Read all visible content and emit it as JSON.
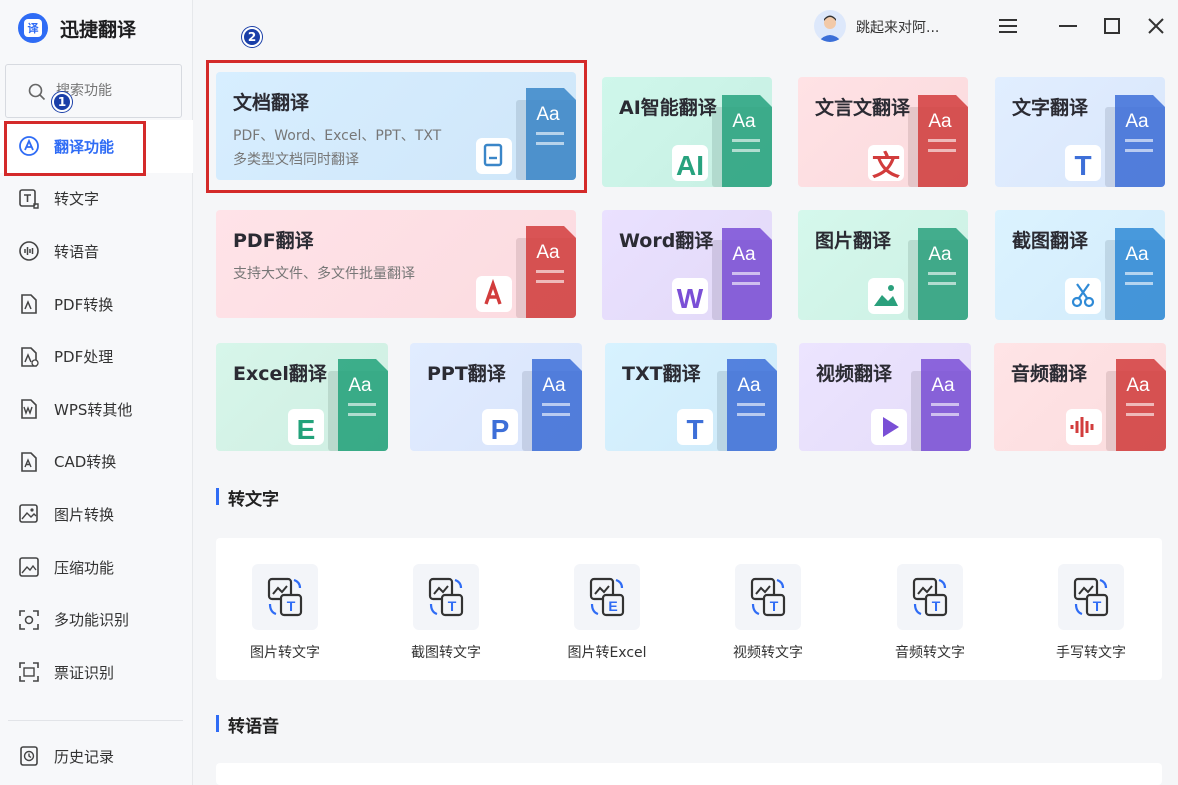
{
  "app": {
    "name": "迅捷翻译",
    "logo_glyph": "译"
  },
  "search": {
    "placeholder": "搜索功能"
  },
  "annotations": {
    "step1": "1",
    "step2": "2",
    "highlight_color": "#d42a2a"
  },
  "sidebar": {
    "items": [
      {
        "label": "翻译功能",
        "icon": "translate-icon",
        "active": true
      },
      {
        "label": "转文字",
        "icon": "text-convert-icon"
      },
      {
        "label": "转语音",
        "icon": "voice-icon"
      },
      {
        "label": "PDF转换",
        "icon": "pdf-convert-icon"
      },
      {
        "label": "PDF处理",
        "icon": "pdf-process-icon"
      },
      {
        "label": "WPS转其他",
        "icon": "wps-icon"
      },
      {
        "label": "CAD转换",
        "icon": "cad-icon"
      },
      {
        "label": "图片转换",
        "icon": "image-convert-icon"
      },
      {
        "label": "压缩功能",
        "icon": "compress-icon"
      },
      {
        "label": "多功能识别",
        "icon": "recognize-icon"
      },
      {
        "label": "票证识别",
        "icon": "ticket-icon"
      }
    ],
    "history_label": "历史记录"
  },
  "topbar": {
    "username": "跳起来对阿..."
  },
  "feature_cards": [
    {
      "title": "文档翻译",
      "desc_line1": "PDF、Word、Excel、PPT、TXT",
      "desc_line2": "多类型文档同时翻译",
      "badge": "doc",
      "color": "#cfe6f9"
    },
    {
      "title": "AI智能翻译",
      "badge": "AI",
      "color": "#c7efe3"
    },
    {
      "title": "文言文翻译",
      "badge": "文",
      "color": "#fadadd"
    },
    {
      "title": "文字翻译",
      "badge": "T",
      "color": "#d9e6fb"
    },
    {
      "title": "PDF翻译",
      "desc_line1": "支持大文件、多文件批量翻译",
      "badge": "pdf",
      "color": "#fbdbe0"
    },
    {
      "title": "Word翻译",
      "badge": "W",
      "color": "#e2d9f7"
    },
    {
      "title": "图片翻译",
      "badge": "img",
      "color": "#cdf0e4"
    },
    {
      "title": "截图翻译",
      "badge": "cut",
      "color": "#d3ebfb"
    },
    {
      "title": "Excel翻译",
      "badge": "E",
      "color": "#cfeee2"
    },
    {
      "title": "PPT翻译",
      "badge": "P",
      "color": "#d9e4fb"
    },
    {
      "title": "TXT翻译",
      "badge": "T",
      "color": "#cfeaf9"
    },
    {
      "title": "视频翻译",
      "badge": "play",
      "color": "#e4dcf8"
    },
    {
      "title": "音频翻译",
      "badge": "wave",
      "color": "#fbdcde"
    }
  ],
  "card_aa": "Aa",
  "sections": {
    "text": {
      "title": "转文字",
      "tools": [
        {
          "label": "图片转文字",
          "icon": "image-to-text-icon",
          "glyph": "T"
        },
        {
          "label": "截图转文字",
          "icon": "screenshot-to-text-icon",
          "glyph": "T"
        },
        {
          "label": "图片转Excel",
          "icon": "image-to-excel-icon",
          "glyph": "E"
        },
        {
          "label": "视频转文字",
          "icon": "video-to-text-icon",
          "glyph": "T"
        },
        {
          "label": "音频转文字",
          "icon": "audio-to-text-icon",
          "glyph": "T"
        },
        {
          "label": "手写转文字",
          "icon": "handwriting-to-text-icon",
          "glyph": "T"
        }
      ]
    },
    "voice": {
      "title": "转语音"
    }
  }
}
